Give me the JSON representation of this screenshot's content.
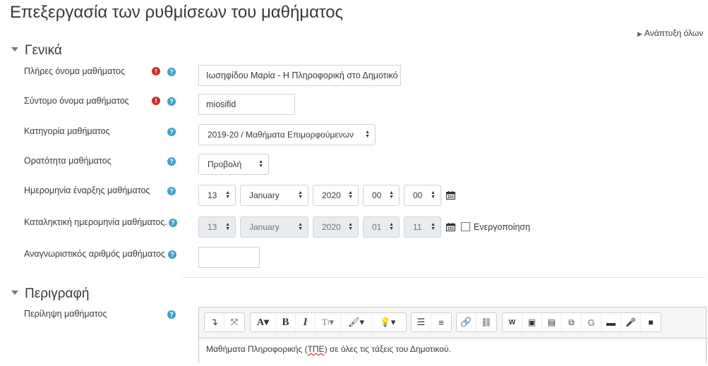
{
  "page": {
    "title": "Επεξεργασία των ρυθμίσεων του μαθήματος",
    "expand_all": "Ανάπτυξη όλων"
  },
  "sections": {
    "general": "Γενικά",
    "description": "Περιγραφή"
  },
  "fields": {
    "fullname": {
      "label": "Πλήρες όνομα μαθήματος",
      "value": "Ιωσηφίδου Μαρία - Η Πληροφορική στο Δημοτικό"
    },
    "shortname": {
      "label": "Σύντομο όνομα μαθήματος",
      "value": "miosifid"
    },
    "category": {
      "label": "Κατηγορία μαθήματος",
      "value": "2019-20 / Μαθήματα Επιμορφούμενων"
    },
    "visibility": {
      "label": "Ορατότητα μαθήματος",
      "value": "Προβολή"
    },
    "startdate": {
      "label": "Ημερομηνία έναρξης μαθήματος",
      "day": "13",
      "month": "January",
      "year": "2020",
      "hour": "00",
      "minute": "00"
    },
    "enddate": {
      "label": "Καταληκτική ημερομηνία μαθήματος.",
      "day": "13",
      "month": "January",
      "year": "2020",
      "hour": "01",
      "minute": "11",
      "enable_label": "Ενεργοποίηση",
      "enabled": false
    },
    "idnumber": {
      "label": "Αναγνωριστικός αριθμός μαθήματος",
      "value": ""
    },
    "summary": {
      "label": "Περίληψη μαθήματος",
      "content_before": "Μαθήματα Πληροφορικής (",
      "content_squiggle": "ΤΠΕ",
      "content_after": ") σε όλες τις τάξεις του Δημοτικού."
    }
  },
  "toolbar": {
    "icons": [
      "collapse-icon",
      "fullscreen-icon",
      "font-family-icon",
      "bold-icon",
      "italic-icon",
      "text-format-icon",
      "brush-icon",
      "lightbulb-icon",
      "bullet-list-icon",
      "numbered-list-icon",
      "link-icon",
      "unlink-icon",
      "word-icon",
      "image-icon",
      "media-file-icon",
      "copy-icon",
      "g-icon",
      "screen-icon",
      "microphone-icon",
      "video-icon"
    ]
  },
  "colors": {
    "required": "#c9302c",
    "help": "#3ea2c9"
  }
}
